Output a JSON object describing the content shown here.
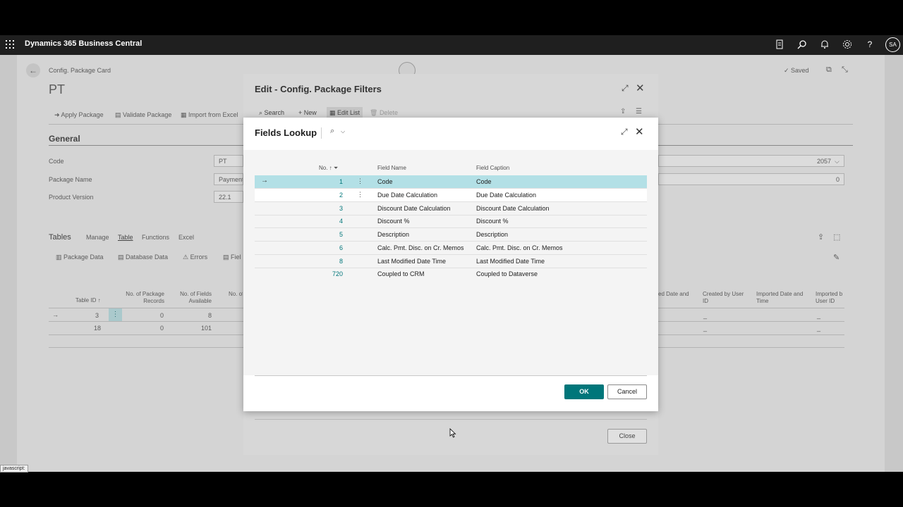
{
  "app": {
    "title": "Dynamics 365 Business Central",
    "avatar_initials": "SA",
    "icons": [
      "waffle-icon",
      "document-icon",
      "search-icon",
      "bell-icon",
      "gear-icon",
      "help-icon"
    ]
  },
  "background_page": {
    "breadcrumb": "Config. Package Card",
    "record_title": "PT",
    "saved_label": "Saved",
    "actions": [
      "Apply Package",
      "Validate Package",
      "Import from Excel"
    ],
    "general_header": "General",
    "fields": [
      {
        "label": "Code",
        "value": "PT"
      },
      {
        "label": "Package Name",
        "value": "Payment"
      },
      {
        "label": "Product Version",
        "value": "22.1"
      }
    ],
    "right_values": [
      "2057",
      "0"
    ],
    "tables_tabs": [
      "Tables",
      "Manage",
      "Table",
      "Functions",
      "Excel"
    ],
    "tables_actions": [
      "Package Data",
      "Database Data",
      "Errors",
      "Fiel"
    ],
    "table_headers": [
      "Table ID ↑",
      "No. of Package Records",
      "No. of Fields Available",
      "No. of In"
    ],
    "right_headers": [
      "ed Date and",
      "Created by User ID",
      "Imported Date and Time",
      "Imported b User ID"
    ],
    "table_rows": [
      {
        "table_id": "3",
        "records": "0",
        "fields": "8"
      },
      {
        "table_id": "18",
        "records": "0",
        "fields": "101"
      }
    ],
    "dash": "_"
  },
  "filters_dialog": {
    "title": "Edit - Config. Package Filters",
    "toolbar": [
      "Search",
      "New",
      "Edit List",
      "Delete"
    ],
    "close_label": "Close"
  },
  "lookup": {
    "title": "Fields Lookup",
    "columns": {
      "no": "No. ↑",
      "field_name": "Field Name",
      "field_caption": "Field Caption"
    },
    "rows": [
      {
        "no": "1",
        "field_name": "Code",
        "field_caption": "Code"
      },
      {
        "no": "2",
        "field_name": "Due Date Calculation",
        "field_caption": "Due Date Calculation"
      },
      {
        "no": "3",
        "field_name": "Discount Date Calculation",
        "field_caption": "Discount Date Calculation"
      },
      {
        "no": "4",
        "field_name": "Discount %",
        "field_caption": "Discount %"
      },
      {
        "no": "5",
        "field_name": "Description",
        "field_caption": "Description"
      },
      {
        "no": "6",
        "field_name": "Calc. Pmt. Disc. on Cr. Memos",
        "field_caption": "Calc. Pmt. Disc. on Cr. Memos"
      },
      {
        "no": "8",
        "field_name": "Last Modified Date Time",
        "field_caption": "Last Modified Date Time"
      },
      {
        "no": "720",
        "field_name": "Coupled to CRM",
        "field_caption": "Coupled to Dataverse"
      }
    ],
    "ok_label": "OK",
    "cancel_label": "Cancel"
  },
  "status_bar": "javascript:",
  "colors": {
    "accent": "#00767a",
    "selected_row": "#b3e0e6",
    "topbar": "#1f1f1f"
  }
}
